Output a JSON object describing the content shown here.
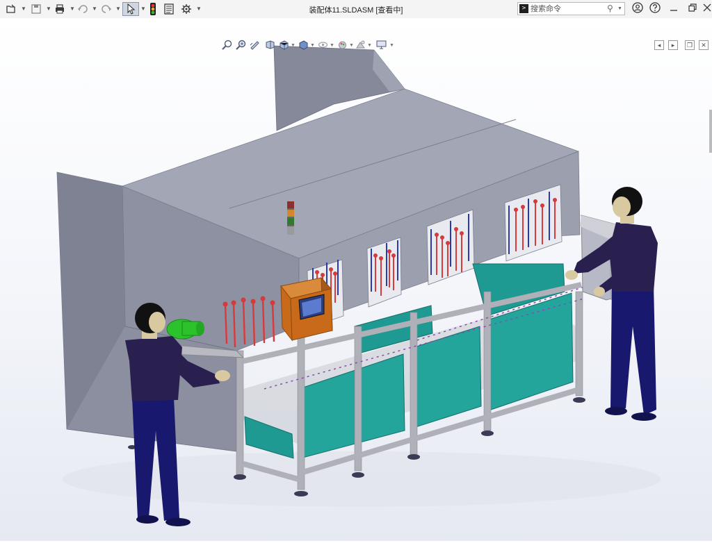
{
  "titlebar": {
    "document_title": "装配体11.SLDASM [查看中]",
    "search": {
      "placeholder": "搜索命令"
    },
    "icons": [
      "file-open-icon",
      "save-icon",
      "print-icon",
      "undo-icon",
      "redo-icon",
      "select-pointer-icon",
      "traffic-light-icon",
      "file-properties-icon",
      "options-gear-icon"
    ],
    "right_icons": [
      "user-account-icon",
      "help-icon",
      "minimize-icon",
      "restore-icon",
      "close-icon"
    ]
  },
  "viewbar": {
    "icons": [
      "zoom-to-fit-icon",
      "zoom-to-area-icon",
      "previous-view-icon",
      "section-view-icon",
      "view-orientation-icon",
      "display-style-icon",
      "hide-show-items-icon",
      "edit-appearance-icon",
      "apply-scene-icon",
      "view-settings-icon"
    ]
  },
  "viewport_tools": [
    "expand-left-icon",
    "expand-right-icon",
    "restore-pane-icon",
    "close-pane-icon"
  ],
  "colors": {
    "housing": "#9a9dac",
    "housing_side": "#8a8d9c",
    "tank": "#1f9a92",
    "frame": "#b0b0b8",
    "control_box": "#c86a1a",
    "worker_shirt": "#2a2050",
    "worker_pants": "#18186e",
    "skin": "#d9c9a0",
    "hair": "#111111",
    "motor": "#2bc22b",
    "nozzle_red": "#d63a3a",
    "nozzle_blue": "#2a3aa8"
  }
}
